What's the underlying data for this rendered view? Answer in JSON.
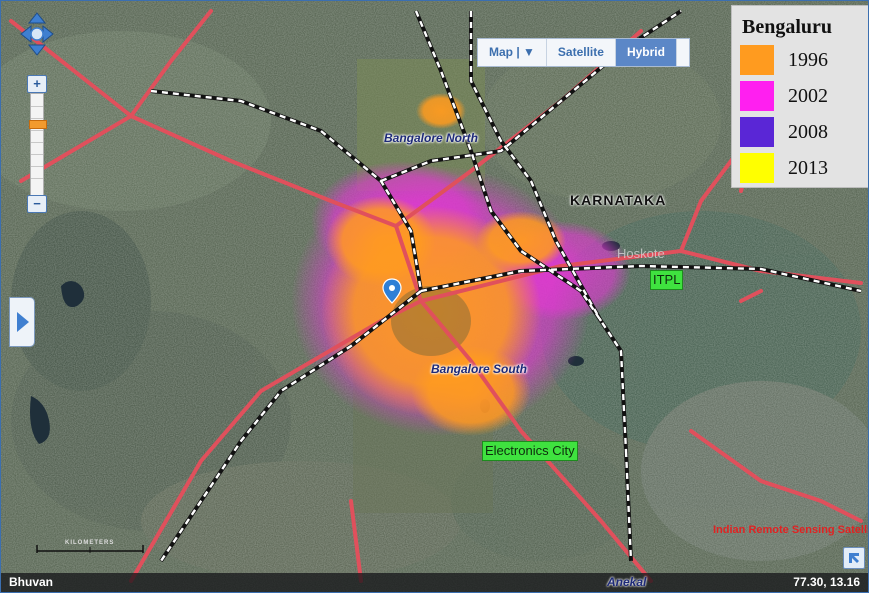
{
  "map": {
    "map_type_tabs": [
      {
        "label": "Map | ▼",
        "active": false
      },
      {
        "label": "Satellite",
        "active": false
      },
      {
        "label": "Hybrid",
        "active": true
      }
    ],
    "legend": {
      "title": "Bengaluru",
      "items": [
        {
          "label": "1996",
          "color": "#ff9b1f"
        },
        {
          "label": "2002",
          "color": "#ff1ff0"
        },
        {
          "label": "2008",
          "color": "#5a26d6"
        },
        {
          "label": "2013",
          "color": "#ffff00"
        }
      ]
    },
    "labels": {
      "north": "Bangalore North",
      "south": "Bangalore South",
      "state": "KARNATAKA",
      "hoskote": "Hoskote",
      "itpl": "ITPL",
      "electronics_city": "Electronics City",
      "anekal": "Anekal",
      "watermark": "Indian Remote Sensing Satellites"
    },
    "scale_label": "KILOMETERS",
    "zoom_level_fraction": 0.72,
    "brand": "Bhuvan",
    "coordinates": "77.30, 13.16",
    "colors": {
      "road": "#e0505c",
      "rail": "#ffffff",
      "satellite_base": "#4d5b47",
      "accent": "#5b87c7"
    }
  }
}
